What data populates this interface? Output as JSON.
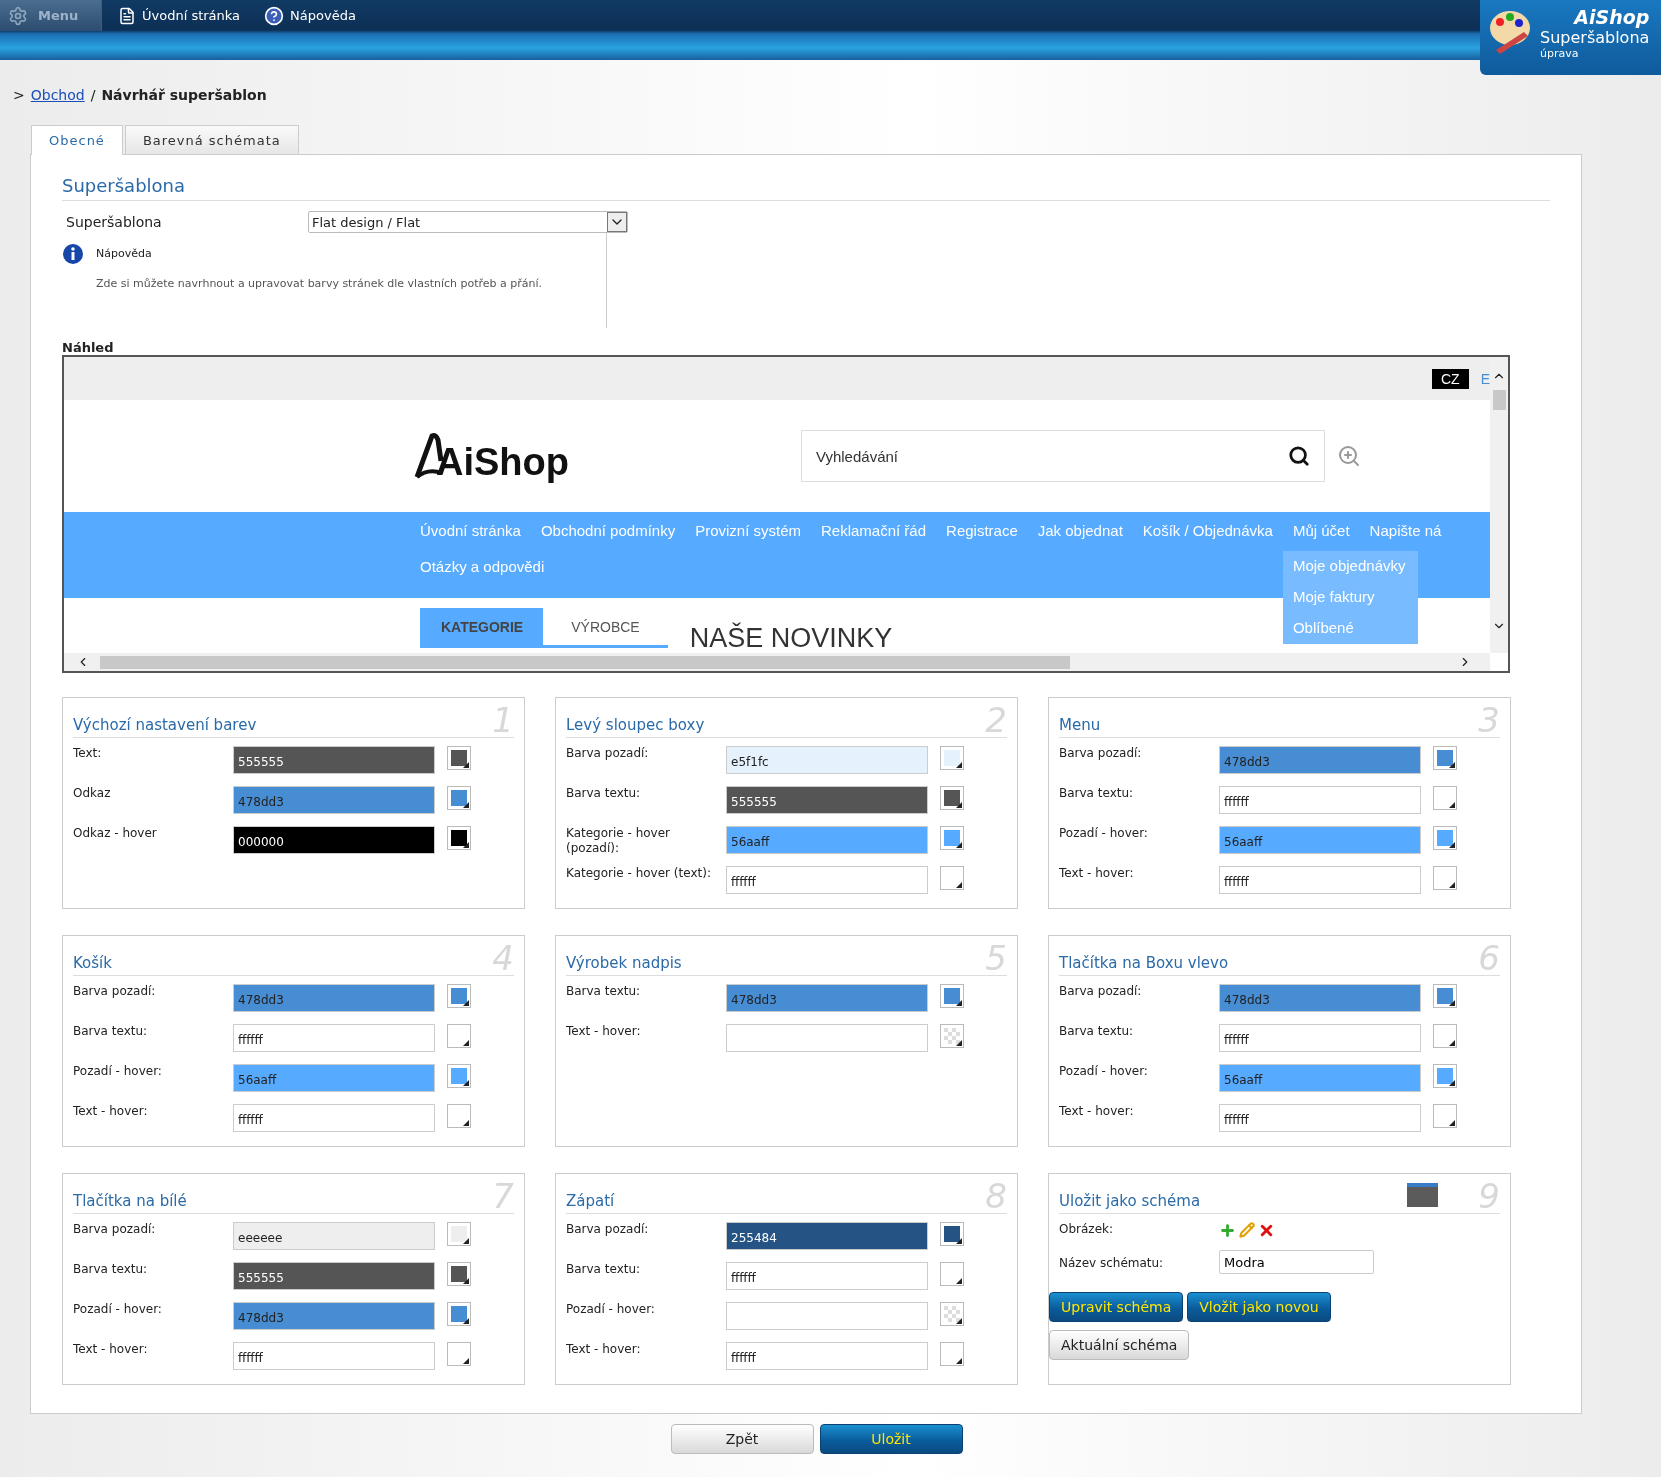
{
  "topbar": {
    "menu": "Menu",
    "links": [
      {
        "label": "Úvodní stránka",
        "kind": "page"
      },
      {
        "label": "Nápověda",
        "kind": "help"
      }
    ],
    "brand": {
      "name": "AiShop",
      "title": "Superšablona",
      "subtitle": "úprava"
    }
  },
  "breadcrumb": {
    "prefix": ">",
    "link": "Obchod",
    "separator": "/",
    "current": "Návrhář superšablon"
  },
  "tabs": [
    {
      "label": "Obecné",
      "selected": true
    },
    {
      "label": "Barevná schémata",
      "selected": false
    }
  ],
  "form": {
    "section_title": "Superšablona",
    "field_label": "Superšablona",
    "select_value": "Flat design / Flat",
    "help_title": "Nápověda",
    "help_text": "Zde si můžete navrhnout a upravovat barvy stránek dle vlastních potřeb a přání."
  },
  "preview": {
    "label": "Náhled",
    "languages": [
      {
        "label": "CZ",
        "selected": true
      },
      {
        "label": "E",
        "selected": false
      }
    ],
    "logo": "AiShop",
    "search_placeholder": "Vyhledávání",
    "nav_rows": [
      {
        "items": [
          {
            "label": "Úvodní stránka"
          },
          {
            "label": "Obchodní podmínky"
          },
          {
            "label": "Provizní systém"
          },
          {
            "label": "Reklamační řád"
          },
          {
            "label": "Registrace"
          },
          {
            "label": "Jak objednat"
          },
          {
            "label": "Košík / Objednávka"
          },
          {
            "label": "Můj účet",
            "submenu": [
              "Moje objednávky",
              "Moje faktury",
              "Oblíbené"
            ]
          },
          {
            "label": "Napište ná"
          }
        ]
      },
      {
        "items": [
          {
            "label": "Otázky a odpovědi"
          }
        ]
      }
    ],
    "category_tabs": [
      {
        "label": "KATEGORIE",
        "selected": true
      },
      {
        "label": "VÝROBCE",
        "selected": false
      }
    ],
    "heading": "NAŠE NOVINKY"
  },
  "panels": [
    {
      "kind": "colors",
      "title": "Výchozí nastavení barev",
      "number": "1",
      "rows": [
        {
          "label": "Text:",
          "value": "555555",
          "color": "#555555"
        },
        {
          "label": "Odkaz",
          "value": "478dd3",
          "color": "#478dd3"
        },
        {
          "label": "Odkaz - hover",
          "value": "000000",
          "color": "#000000"
        }
      ]
    },
    {
      "kind": "colors",
      "title": "Levý sloupec boxy",
      "number": "2",
      "rows": [
        {
          "label": "Barva pozadí:",
          "value": "e5f1fc",
          "color": "#e5f1fc"
        },
        {
          "label": "Barva textu:",
          "value": "555555",
          "color": "#555555"
        },
        {
          "label": "Kategorie - hover (pozadí):",
          "value": "56aaff",
          "color": "#56aaff"
        },
        {
          "label": "Kategorie - hover (text):",
          "value": "ffffff",
          "color": "#ffffff"
        }
      ]
    },
    {
      "kind": "colors",
      "title": "Menu",
      "number": "3",
      "rows": [
        {
          "label": "Barva pozadí:",
          "value": "478dd3",
          "color": "#478dd3"
        },
        {
          "label": "Barva textu:",
          "value": "ffffff",
          "color": "#ffffff"
        },
        {
          "label": "Pozadí - hover:",
          "value": "56aaff",
          "color": "#56aaff"
        },
        {
          "label": "Text - hover:",
          "value": "ffffff",
          "color": "#ffffff"
        }
      ]
    },
    {
      "kind": "colors",
      "title": "Košík",
      "number": "4",
      "rows": [
        {
          "label": "Barva pozadí:",
          "value": "478dd3",
          "color": "#478dd3"
        },
        {
          "label": "Barva textu:",
          "value": "ffffff",
          "color": "#ffffff"
        },
        {
          "label": "Pozadí - hover:",
          "value": "56aaff",
          "color": "#56aaff"
        },
        {
          "label": "Text - hover:",
          "value": "ffffff",
          "color": "#ffffff"
        }
      ]
    },
    {
      "kind": "colors",
      "title": "Výrobek nadpis",
      "number": "5",
      "rows": [
        {
          "label": "Barva textu:",
          "value": "478dd3",
          "color": "#478dd3"
        },
        {
          "label": "Text - hover:"
        }
      ]
    },
    {
      "kind": "colors",
      "title": "Tlačítka na Boxu vlevo",
      "number": "6",
      "rows": [
        {
          "label": "Barva pozadí:",
          "value": "478dd3",
          "color": "#478dd3"
        },
        {
          "label": "Barva textu:",
          "value": "ffffff",
          "color": "#ffffff"
        },
        {
          "label": "Pozadí - hover:",
          "value": "56aaff",
          "color": "#56aaff"
        },
        {
          "label": "Text - hover:",
          "value": "ffffff",
          "color": "#ffffff"
        }
      ]
    },
    {
      "kind": "colors",
      "title": "Tlačítka na bílé",
      "number": "7",
      "rows": [
        {
          "label": "Barva pozadí:",
          "value": "eeeeee",
          "color": "#eeeeee"
        },
        {
          "label": "Barva textu:",
          "value": "555555",
          "color": "#555555"
        },
        {
          "label": "Pozadí - hover:",
          "value": "478dd3",
          "color": "#478dd3"
        },
        {
          "label": "Text - hover:",
          "value": "ffffff",
          "color": "#ffffff"
        }
      ]
    },
    {
      "kind": "colors",
      "title": "Zápatí",
      "number": "8",
      "rows": [
        {
          "label": "Barva pozadí:",
          "value": "255484",
          "color": "#255484"
        },
        {
          "label": "Barva textu:",
          "value": "ffffff",
          "color": "#ffffff"
        },
        {
          "label": "Pozadí - hover:"
        },
        {
          "label": "Text - hover:",
          "value": "ffffff",
          "color": "#ffffff"
        }
      ]
    },
    {
      "kind": "save",
      "title": "Uložit jako schéma",
      "number": "9",
      "image_label": "Obrázek:",
      "name_label": "Název schématu:",
      "name_value": "Modra",
      "buttons": [
        {
          "label": "Upravit schéma",
          "kind": "primary"
        },
        {
          "label": "Vložit jako novou",
          "kind": "primary"
        },
        {
          "label": "Aktuální schéma",
          "kind": "secondary"
        }
      ]
    }
  ],
  "footer_buttons": [
    {
      "label": "Zpět",
      "kind": "secondary"
    },
    {
      "label": "Uložit",
      "kind": "primary"
    }
  ]
}
